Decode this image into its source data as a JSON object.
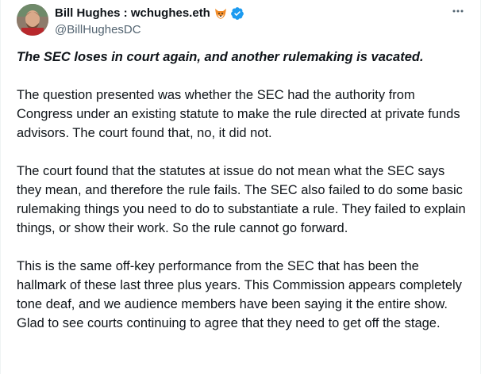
{
  "author": {
    "display_name": "Bill Hughes : wchughes.eth",
    "handle": "@BillHughesDC",
    "badges": [
      "fox-emoji-icon",
      "verified-badge-icon"
    ],
    "avatar": "profile-photo"
  },
  "menu": {
    "more_icon": "ellipsis-icon"
  },
  "tweet": {
    "headline": "The SEC loses in court again, and another rulemaking is vacated.",
    "paragraphs": [
      "The question presented was whether the SEC had the authority from Congress under an existing statute to make the rule directed at private funds advisors.  The court found that, no, it did not.",
      "The court found that the statutes at issue do not mean what the SEC says they mean, and therefore the rule fails.  The SEC also failed to do some basic rulemaking things you need to do to substantiate a rule.  They failed to explain things, or show their work.  So the rule cannot go forward.",
      "This is the same off-key performance from the SEC that has been the hallmark of these last three plus years.  This Commission appears completely tone deaf, and we audience members have been saying it the entire show.  Glad to see courts continuing to agree that they need to get off the stage."
    ]
  },
  "colors": {
    "text_primary": "#0f1419",
    "text_secondary": "#536471",
    "verified_blue": "#1d9bf0",
    "border": "#eff3f4"
  }
}
